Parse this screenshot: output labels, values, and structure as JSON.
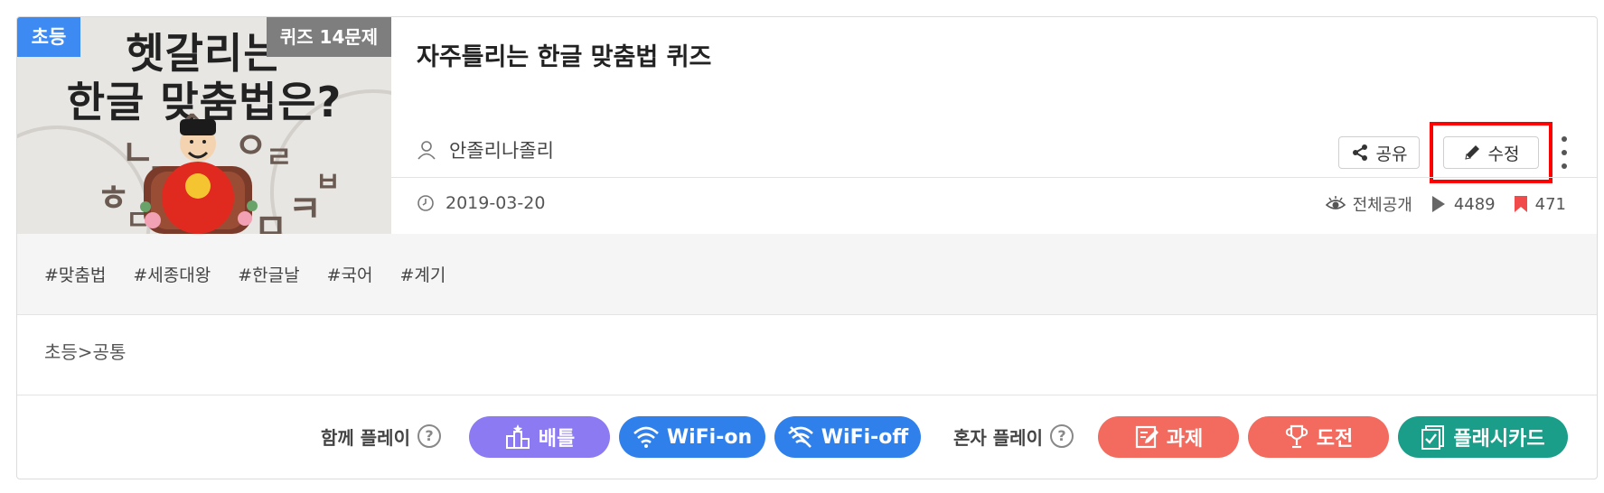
{
  "quiz": {
    "grade_badge": "초등",
    "count_badge": "퀴즈 14문제",
    "thumbnail_heading_1": "헷갈리는",
    "thumbnail_heading_2": "한글 맞춤법은?",
    "title": "자주틀리는 한글 맞춤법 퀴즈",
    "author": "안졸리나졸리",
    "date": "2019-03-20",
    "visibility": "전체공개",
    "plays": "4489",
    "bookmarks": "471",
    "category": "초등>공통"
  },
  "actions": {
    "share_label": "공유",
    "edit_label": "수정"
  },
  "tags": [
    "#맞춤법",
    "#세종대왕",
    "#한글날",
    "#국어",
    "#계기"
  ],
  "together_play": {
    "label": "함께 플레이",
    "buttons": [
      "배틀",
      "WiFi-on",
      "WiFi-off"
    ]
  },
  "solo_play": {
    "label": "혼자 플레이",
    "buttons": [
      "과제",
      "도전",
      "플래시카드"
    ]
  },
  "colors": {
    "grade_badge": "#3d8bf2",
    "battle": "#8c7af2",
    "wifi": "#2f80ea",
    "solo": "#f26b5e",
    "flashcard": "#1a9e8a",
    "highlight": "#ff0000",
    "bookmark": "#f04a4a"
  }
}
